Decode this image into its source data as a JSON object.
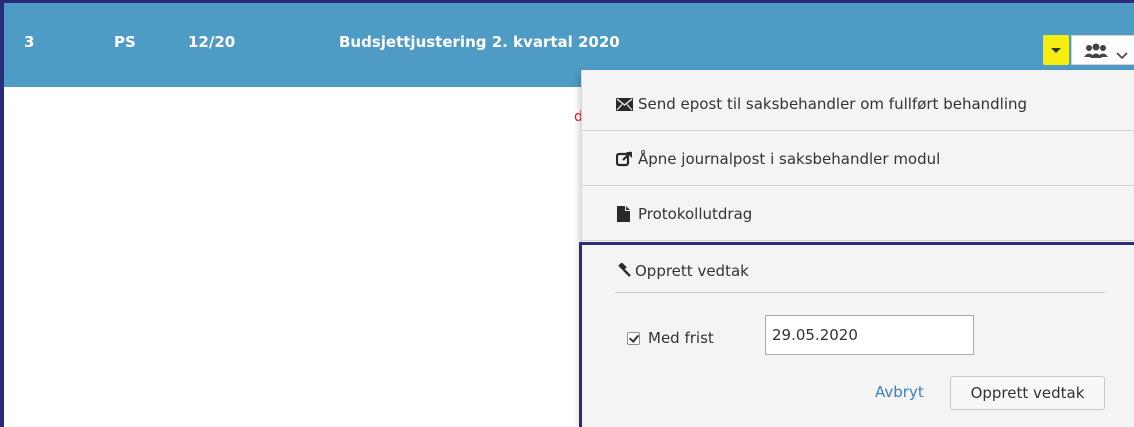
{
  "row": {
    "number": "3",
    "type": "PS",
    "case_id": "12/20",
    "title": "Budsjettjustering 2. kvartal 2020"
  },
  "row_marker": "d",
  "menu": {
    "items": [
      {
        "label": "Send epost til saksbehandler om fullført behandling",
        "icon": "envelope-icon"
      },
      {
        "label": "Åpne journalpost i saksbehandler modul",
        "icon": "external-link-icon"
      },
      {
        "label": "Protokollutdrag",
        "icon": "document-icon"
      }
    ]
  },
  "vedtak": {
    "heading": "Opprett vedtak",
    "icon": "gavel-icon",
    "deadline_checkbox_label": "Med frist",
    "deadline_checked": true,
    "deadline_value": "29.05.2020",
    "cancel_label": "Avbryt",
    "submit_label": "Opprett vedtak"
  },
  "colors": {
    "row_bar": "#4e9bc6",
    "toggle_highlight": "#f5ee10",
    "focus_border": "#2c2b7a",
    "link": "#3b7fc4"
  }
}
